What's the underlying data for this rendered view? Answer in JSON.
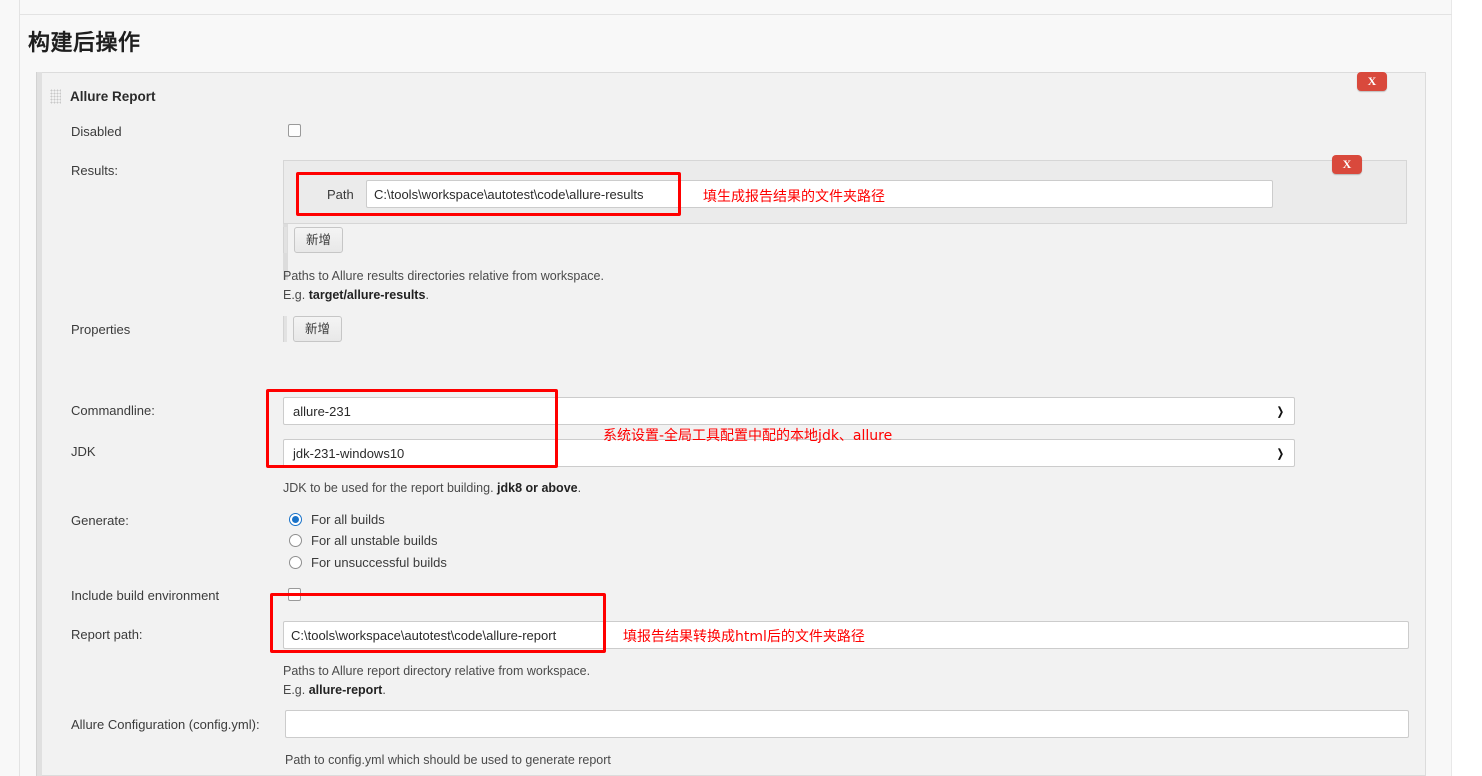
{
  "page": {
    "title": "构建后操作"
  },
  "block": {
    "header": "Allure Report",
    "grip_icon": "drag-handle-icon",
    "close_label": "X"
  },
  "fields": {
    "disabled": {
      "label": "Disabled",
      "checked": false
    },
    "results": {
      "label": "Results:",
      "path_label": "Path",
      "path_value": "C:\\tools\\workspace\\autotest\\code\\allure-results",
      "add_label": "新增",
      "close_label": "X",
      "help_line1": "Paths to Allure results directories relative from workspace.",
      "help_line2_prefix": "E.g. ",
      "help_line2_bold": "target/allure-results",
      "help_line2_suffix": "."
    },
    "properties": {
      "label": "Properties",
      "add_label": "新增"
    },
    "commandline": {
      "label": "Commandline:",
      "value": "allure-231",
      "chevron": "chevron-down-icon"
    },
    "jdk": {
      "label": "JDK",
      "value": "jdk-231-windows10",
      "chevron": "chevron-down-icon",
      "help_prefix": "JDK to be used for the report building. ",
      "help_bold": "jdk8 or above",
      "help_suffix": "."
    },
    "generate": {
      "label": "Generate:",
      "options": [
        {
          "label": "For all builds",
          "selected": true
        },
        {
          "label": "For all unstable builds",
          "selected": false
        },
        {
          "label": "For unsuccessful builds",
          "selected": false
        }
      ]
    },
    "include_build_environment": {
      "label": "Include build environment",
      "checked": false
    },
    "report_path": {
      "label": "Report path:",
      "value": "C:\\tools\\workspace\\autotest\\code\\allure-report",
      "help_line1": "Paths to Allure report directory relative from workspace.",
      "help_line2_prefix": "E.g. ",
      "help_line2_bold": "allure-report",
      "help_line2_suffix": "."
    },
    "allure_configuration": {
      "label": "Allure Configuration (config.yml):",
      "value": "",
      "help": "Path to config.yml which should be used to generate report"
    }
  },
  "annotations": {
    "results_path": "填生成报告结果的文件夹路径",
    "commandline_jdk": "系统设置-全局工具配置中配的本地jdk、allure",
    "report_path": "填报告结果转换成html后的文件夹路径",
    "color": "#ff0000"
  }
}
